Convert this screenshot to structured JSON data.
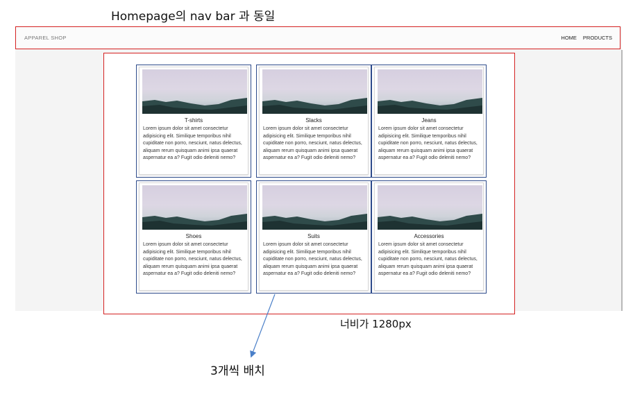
{
  "annotations": {
    "top": "Homepage의 nav bar 과 동일",
    "width": "너비가 1280px",
    "layout": "3개씩 배치"
  },
  "navbar": {
    "brand": "APPAREL SHOP",
    "links": [
      "HOME",
      "PRODUCTS"
    ]
  },
  "cards": [
    {
      "title": "T-shirts",
      "text": "Lorem ipsum dolor sit amet consectetur adipisicing elit. Similique temporibus nihil cupiditate non porro, nesciunt, natus delectus, aliquam rerum quisquam animi ipsa quaerat aspernatur ea a? Fugit odio deleniti nemo?"
    },
    {
      "title": "Slacks",
      "text": "Lorem ipsum dolor sit amet consectetur adipisicing elit. Similique temporibus nihil cupiditate non porro, nesciunt, natus delectus, aliquam rerum quisquam animi ipsa quaerat aspernatur ea a? Fugit odio deleniti nemo?"
    },
    {
      "title": "Jeans",
      "text": "Lorem ipsum dolor sit amet consectetur adipisicing elit. Similique temporibus nihil cupiditate non porro, nesciunt, natus delectus, aliquam rerum quisquam animi ipsa quaerat aspernatur ea a? Fugit odio deleniti nemo?"
    },
    {
      "title": "Shoes",
      "text": "Lorem ipsum dolor sit amet consectetur adipisicing elit. Similique temporibus nihil cupiditate non porro, nesciunt, natus delectus, aliquam rerum quisquam animi ipsa quaerat aspernatur ea a? Fugit odio deleniti nemo?"
    },
    {
      "title": "Suits",
      "text": "Lorem ipsum dolor sit amet consectetur adipisicing elit. Similique temporibus nihil cupiditate non porro, nesciunt, natus delectus, aliquam rerum quisquam animi ipsa quaerat aspernatur ea a? Fugit odio deleniti nemo?"
    },
    {
      "title": "Accessories",
      "text": "Lorem ipsum dolor sit amet consectetur adipisicing elit. Similique temporibus nihil cupiditate non porro, nesciunt, natus delectus, aliquam rerum quisquam animi ipsa quaerat aspernatur ea a? Fugit odio deleniti nemo?"
    }
  ],
  "colors": {
    "annotation_red": "#d42020",
    "card_border_blue": "#2c4a8a",
    "arrow_blue": "#4a7fc8"
  }
}
